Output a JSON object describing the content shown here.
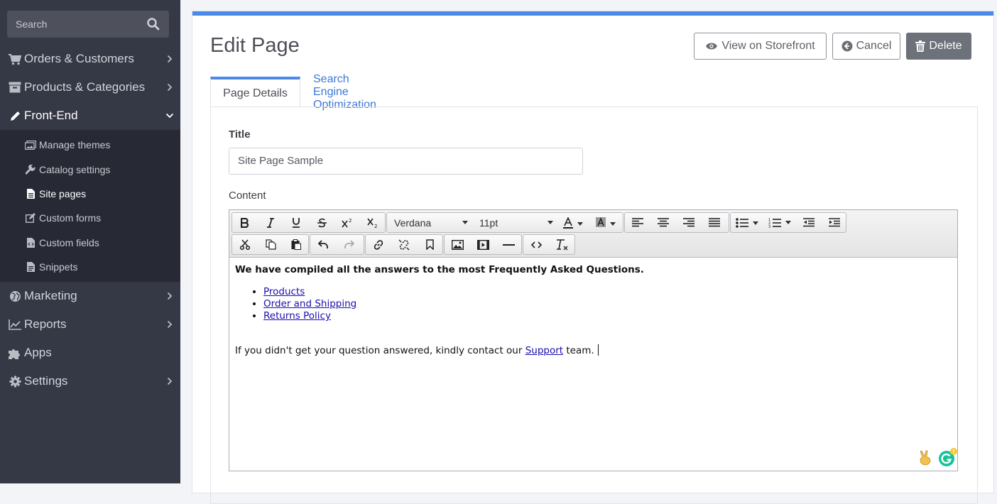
{
  "sidebar": {
    "search_placeholder": "Search",
    "items": [
      {
        "label": "Orders & Customers",
        "icon": "cart-icon"
      },
      {
        "label": "Products & Categories",
        "icon": "archive-icon"
      },
      {
        "label": "Front-End",
        "icon": "pencil-icon"
      },
      {
        "label": "Marketing",
        "icon": "globe-icon"
      },
      {
        "label": "Reports",
        "icon": "chart-line-icon"
      },
      {
        "label": "Apps",
        "icon": "puzzle-icon"
      },
      {
        "label": "Settings",
        "icon": "gear-icon"
      }
    ],
    "subitems": [
      {
        "label": "Manage themes",
        "icon": "images-icon"
      },
      {
        "label": "Catalog settings",
        "icon": "wrench-icon"
      },
      {
        "label": "Site pages",
        "icon": "file-icon"
      },
      {
        "label": "Custom forms",
        "icon": "edit-icon"
      },
      {
        "label": "Custom fields",
        "icon": "file-code-icon"
      },
      {
        "label": "Snippets",
        "icon": "file-text-icon"
      }
    ]
  },
  "header": {
    "title": "Edit Page",
    "view_label": "View on Storefront",
    "cancel_label": "Cancel",
    "delete_label": "Delete"
  },
  "tabs": [
    {
      "label": "Page Details"
    },
    {
      "label": "Search Engine Optimization"
    }
  ],
  "form": {
    "title_label": "Title",
    "title_value": "Site Page Sample",
    "content_label": "Content"
  },
  "editor": {
    "font_family": "Verdana",
    "font_size": "11pt",
    "intro": "We have compiled all the answers to the most Frequently Asked Questions.",
    "links": [
      "Products",
      "Order and Shipping",
      "Returns Policy"
    ],
    "outro_before": "If you didn't get your question answered, kindly contact our",
    "outro_link": "Support",
    "outro_after": "team."
  },
  "colors": {
    "accent": "#4a89e8",
    "sidebar_bg": "#353845",
    "delete_bg": "#6c717a"
  }
}
